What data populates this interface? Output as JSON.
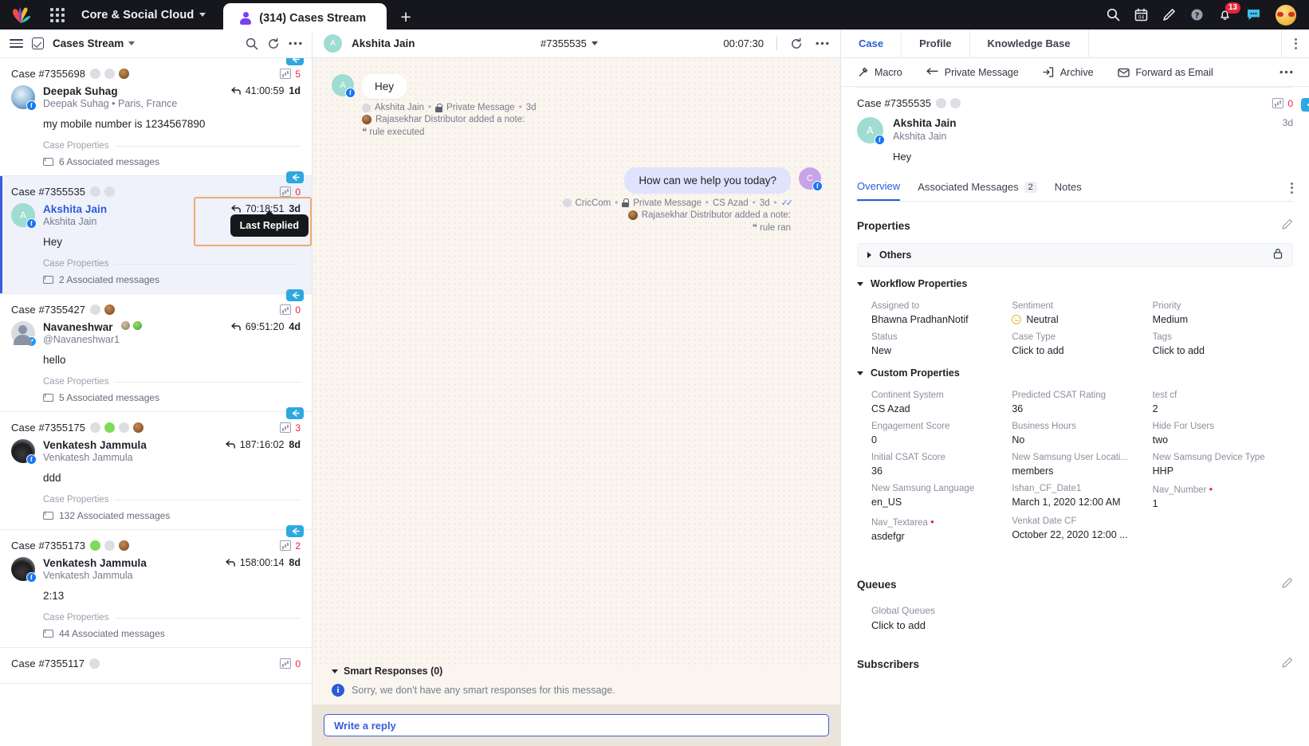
{
  "topbar": {
    "workspace": "Core & Social Cloud",
    "tab_label": "(314) Cases Stream",
    "new_tab": "+",
    "icons": [
      "search-icon",
      "calendar-icon",
      "compose-icon",
      "help-icon",
      "bell-icon",
      "chat-icon",
      "user-avatar"
    ],
    "notification_count": "13",
    "calendar_day": "04"
  },
  "left": {
    "title": "Cases Stream",
    "cases": [
      {
        "case_id": "Case #7355698",
        "chips": [
          "gray",
          "gray",
          "brown"
        ],
        "msg_count": "5",
        "name": "Deepak Suhag",
        "sub": "Deepak Suhag • Paris, France",
        "timer": "41:00:59",
        "age": "1d",
        "preview": "my mobile number is 1234567890",
        "props_label": "Case Properties",
        "assoc": "6 Associated messages",
        "selected": false
      },
      {
        "case_id": "Case #7355535",
        "chips": [
          "gray",
          "gray"
        ],
        "msg_count": "0",
        "name": "Akshita Jain",
        "sub": "Akshita Jain",
        "timer": "70:18:51",
        "age": "3d",
        "preview": "Hey",
        "props_label": "Case Properties",
        "assoc": "2 Associated messages",
        "selected": true,
        "tooltip": "Last Replied"
      },
      {
        "case_id": "Case #7355427",
        "chips": [
          "gray",
          "brown"
        ],
        "msg_count": "0",
        "name": "Navaneshwar",
        "sub": "@Navaneshwar1",
        "timer": "69:51:20",
        "age": "4d",
        "preview": "hello",
        "props_label": "Case Properties",
        "assoc": "5 Associated messages",
        "selected": false
      },
      {
        "case_id": "Case #7355175",
        "chips": [
          "gray",
          "green",
          "gray",
          "brown"
        ],
        "msg_count": "3",
        "name": "Venkatesh Jammula",
        "sub": "Venkatesh Jammula",
        "timer": "187:16:02",
        "age": "8d",
        "preview": "ddd",
        "props_label": "Case Properties",
        "assoc": "132 Associated messages",
        "selected": false
      },
      {
        "case_id": "Case #7355173",
        "chips": [
          "green",
          "gray",
          "brown"
        ],
        "msg_count": "2",
        "name": "Venkatesh Jammula",
        "sub": "Venkatesh Jammula",
        "timer": "158:00:14",
        "age": "8d",
        "preview": "2:13",
        "props_label": "Case Properties",
        "assoc": "44 Associated messages",
        "selected": false
      },
      {
        "case_id": "Case #7355117",
        "chips": [
          "gray"
        ],
        "msg_count": "0",
        "name": "",
        "sub": "",
        "timer": "",
        "age": "",
        "preview": "",
        "props_label": "",
        "assoc": "",
        "selected": false
      }
    ]
  },
  "center": {
    "header": {
      "name": "Akshita Jain",
      "case_id": "#7355535",
      "timer": "00:07:30"
    },
    "messages": [
      {
        "direction": "in",
        "text": "Hey",
        "author": "Akshita Jain",
        "channel": "Private Message",
        "age": "3d",
        "note_author": "Rajasekhar Distributor added a note:",
        "note_text": "rule executed"
      },
      {
        "direction": "out",
        "text": "How can we help you today?",
        "author": "CricCom",
        "channel": "Private Message",
        "agent": "CS Azad",
        "age": "3d",
        "note_author": "Rajasekhar Distributor added a note:",
        "note_text": "rule ran"
      }
    ],
    "smart_responses": {
      "title": "Smart Responses (0)",
      "empty_text": "Sorry, we don't have any smart responses for this message."
    },
    "reply_placeholder": "Write a reply"
  },
  "right": {
    "tabs": [
      {
        "label": "Case",
        "active": true
      },
      {
        "label": "Profile",
        "active": false
      },
      {
        "label": "Knowledge Base",
        "active": false
      }
    ],
    "actions": [
      {
        "label": "Macro",
        "icon": "macro-wand-icon"
      },
      {
        "label": "Private Message",
        "icon": "reply-arrow-icon"
      },
      {
        "label": "Archive",
        "icon": "archive-icon"
      },
      {
        "label": "Forward as Email",
        "icon": "envelope-icon"
      }
    ],
    "case_id": "Case #7355535",
    "msg_count": "0",
    "person": {
      "name": "Akshita Jain",
      "sub": "Akshita Jain",
      "text": "Hey",
      "age": "3d"
    },
    "subtabs": [
      {
        "label": "Overview",
        "count": "",
        "active": true
      },
      {
        "label": "Associated Messages",
        "count": "2",
        "active": false
      },
      {
        "label": "Notes",
        "count": "",
        "active": false
      }
    ],
    "properties_title": "Properties",
    "others_label": "Others",
    "workflow": {
      "title": "Workflow Properties",
      "fields": [
        {
          "label": "Assigned to",
          "value": "Bhawna PradhanNotif"
        },
        {
          "label": "Sentiment",
          "value": "Neutral",
          "icon": "neutral-face-icon"
        },
        {
          "label": "Priority",
          "value": "Medium"
        },
        {
          "label": "Status",
          "value": "New"
        },
        {
          "label": "Case Type",
          "value": "Click to add"
        },
        {
          "label": "Tags",
          "value": "Click to add"
        }
      ]
    },
    "custom": {
      "title": "Custom Properties",
      "fields": [
        {
          "label": "Continent System",
          "value": "CS Azad"
        },
        {
          "label": "Predicted CSAT Rating",
          "value": "36"
        },
        {
          "label": "test cf",
          "value": "2"
        },
        {
          "label": "Engagement Score",
          "value": "0"
        },
        {
          "label": "Business Hours",
          "value": "No"
        },
        {
          "label": "Hide For Users",
          "value": "two"
        },
        {
          "label": "Initial CSAT Score",
          "value": "36"
        },
        {
          "label": "New Samsung User Locati...",
          "value": "members"
        },
        {
          "label": "New Samsung Device Type",
          "value": "HHP"
        },
        {
          "label": "New Samsung Language",
          "value": "en_US"
        },
        {
          "label": "Ishan_CF_Date1",
          "value": "March 1, 2020 12:00 AM"
        },
        {
          "label": "Nav_Number",
          "value": "1",
          "required": true
        },
        {
          "label": "Nav_Textarea",
          "value": "asdefgr",
          "required": true
        },
        {
          "label": "Venkat Date CF",
          "value": "October 22, 2020 12:00 ..."
        }
      ]
    },
    "queues": {
      "title": "Queues",
      "label": "Global Queues",
      "value": "Click to add"
    },
    "subscribers_title": "Subscribers"
  }
}
